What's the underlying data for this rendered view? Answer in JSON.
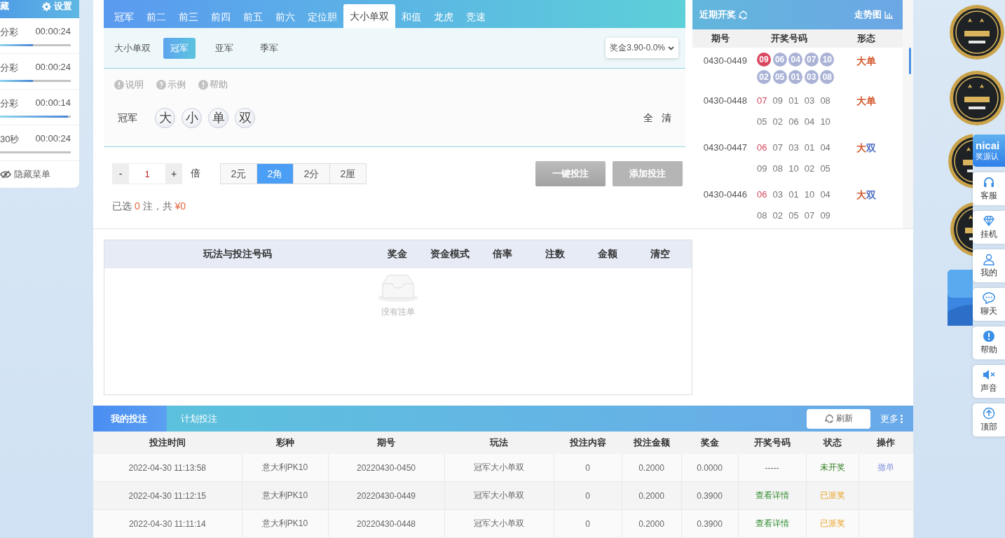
{
  "sidebar": {
    "header": "藏",
    "settings": "设置",
    "games": [
      {
        "name": "分彩",
        "time": "00:00:24",
        "level": 0.47
      },
      {
        "name": "分彩",
        "time": "00:00:24",
        "level": 0.47
      },
      {
        "name": "分彩",
        "time": "00:00:14",
        "level": 0.96
      },
      {
        "name": "30秒",
        "time": "00:00:24",
        "level": 0
      }
    ],
    "hide_menu": "隐藏菜单"
  },
  "play_tabs": [
    {
      "label": "冠军",
      "selected": false
    },
    {
      "label": "前二",
      "selected": false
    },
    {
      "label": "前三",
      "selected": false
    },
    {
      "label": "前四",
      "selected": false
    },
    {
      "label": "前五",
      "selected": false
    },
    {
      "label": "前六",
      "selected": false
    },
    {
      "label": "定位胆",
      "selected": false
    },
    {
      "label": "大小单双",
      "selected": true
    },
    {
      "label": "和值",
      "selected": false
    },
    {
      "label": "龙虎",
      "selected": false
    },
    {
      "label": "竞速",
      "selected": false
    }
  ],
  "sub_bar": {
    "label": "大小单双",
    "options": [
      {
        "label": "冠军",
        "selected": true
      },
      {
        "label": "亚军",
        "selected": false
      },
      {
        "label": "季军",
        "selected": false
      }
    ],
    "odds": "奖金3.90-0.0%"
  },
  "help_links": [
    {
      "label": "说明",
      "kind": "info"
    },
    {
      "label": "示例",
      "kind": "example"
    },
    {
      "label": "帮助",
      "kind": "info"
    }
  ],
  "pick_row": {
    "label": "冠军",
    "balls": [
      {
        "label": "大",
        "selected": false
      },
      {
        "label": "小",
        "selected": false
      },
      {
        "label": "单",
        "selected": false
      },
      {
        "label": "双",
        "selected": false
      }
    ],
    "all": "全",
    "clear": "清"
  },
  "multiplier": {
    "minus": "-",
    "value": "1",
    "plus": "+",
    "unit": "倍"
  },
  "units": [
    {
      "label": "2元",
      "selected": false
    },
    {
      "label": "2角",
      "selected": true
    },
    {
      "label": "2分",
      "selected": false
    },
    {
      "label": "2厘",
      "selected": false
    }
  ],
  "buttons": [
    {
      "label": "一键投注",
      "disabled": true
    },
    {
      "label": "添加投注",
      "disabled": true
    }
  ],
  "summary": {
    "prefix": "已选",
    "count": "0",
    "middle": "注，共",
    "amount": "¥0"
  },
  "draws": {
    "title": "近期开奖",
    "trend": "走势图",
    "columns": [
      "期号",
      "开奖号码",
      "形态"
    ],
    "rows": [
      {
        "issue": "0430-0449",
        "kind": "balls",
        "numbers": [
          "09",
          "06",
          "04",
          "07",
          "10",
          "02",
          "05",
          "01",
          "03",
          "08"
        ],
        "pattern": [
          {
            "text": "大",
            "color": "#d2592e"
          },
          {
            "text": "单",
            "color": "#d2592e"
          }
        ]
      },
      {
        "issue": "0430-0448",
        "kind": "plain",
        "numbers": [
          "07",
          "09",
          "01",
          "03",
          "08",
          "05",
          "02",
          "06",
          "04",
          "10"
        ],
        "pattern": [
          {
            "text": "大",
            "color": "#d2592e"
          },
          {
            "text": "单",
            "color": "#d2592e"
          }
        ]
      },
      {
        "issue": "0430-0447",
        "kind": "plain",
        "numbers": [
          "06",
          "07",
          "03",
          "01",
          "04",
          "09",
          "08",
          "10",
          "02",
          "05"
        ],
        "pattern": [
          {
            "text": "大",
            "color": "#d2592e"
          },
          {
            "text": "双",
            "color": "#4f6fc2"
          }
        ]
      },
      {
        "issue": "0430-0446",
        "kind": "plain",
        "numbers": [
          "06",
          "03",
          "01",
          "10",
          "04",
          "08",
          "02",
          "05",
          "07",
          "09"
        ],
        "pattern": [
          {
            "text": "大",
            "color": "#d2592e"
          },
          {
            "text": "双",
            "color": "#4f6fc2"
          }
        ]
      }
    ]
  },
  "order_table": {
    "columns": [
      "玩法与投注号码",
      "奖金",
      "资金模式",
      "倍率",
      "注数",
      "金额",
      "清空"
    ],
    "empty": "没有注单"
  },
  "records": {
    "tabs": [
      {
        "label": "我的投注",
        "selected": true
      },
      {
        "label": "计划投注",
        "selected": false
      }
    ],
    "refresh": "刷新",
    "more": "更多",
    "columns": [
      "投注时间",
      "彩种",
      "期号",
      "玩法",
      "投注内容",
      "投注金额",
      "奖金",
      "开奖号码",
      "状态",
      "操作"
    ],
    "rows": [
      {
        "cells": [
          "2022-04-30 11:13:58",
          "意大利PK10",
          "20220430-0450",
          "冠军大小单双",
          "0",
          "0.2000",
          "0.0000"
        ],
        "draw": {
          "text": "-----",
          "kind": "plain"
        },
        "status": {
          "text": "未开奖",
          "kind": "pending"
        },
        "action": {
          "text": "撤单",
          "kind": "link"
        }
      },
      {
        "cells": [
          "2022-04-30 11:12:15",
          "意大利PK10",
          "20220430-0449",
          "冠军大小单双",
          "0",
          "0.2000",
          "0.3900"
        ],
        "draw": {
          "text": "查看详情",
          "kind": "link"
        },
        "status": {
          "text": "已派奖",
          "kind": "paid"
        }
      },
      {
        "cells": [
          "2022-04-30 11:11:14",
          "意大利PK10",
          "20220430-0448",
          "冠军大小单双",
          "0",
          "0.2000",
          "0.3900"
        ],
        "draw": {
          "text": "查看详情",
          "kind": "link"
        },
        "status": {
          "text": "已派奖",
          "kind": "paid"
        }
      }
    ]
  },
  "certificate": {
    "brand": "nicai",
    "label": "奖源认"
  },
  "float_menu": [
    {
      "label": "客服",
      "kind": "service"
    },
    {
      "label": "挂机",
      "kind": "auto"
    },
    {
      "label": "我的",
      "kind": "user"
    },
    {
      "label": "聊天",
      "kind": "chat"
    },
    {
      "label": "帮助",
      "kind": "help"
    },
    {
      "label": "声音",
      "kind": "sound"
    },
    {
      "label": "顶部",
      "kind": "top"
    }
  ]
}
